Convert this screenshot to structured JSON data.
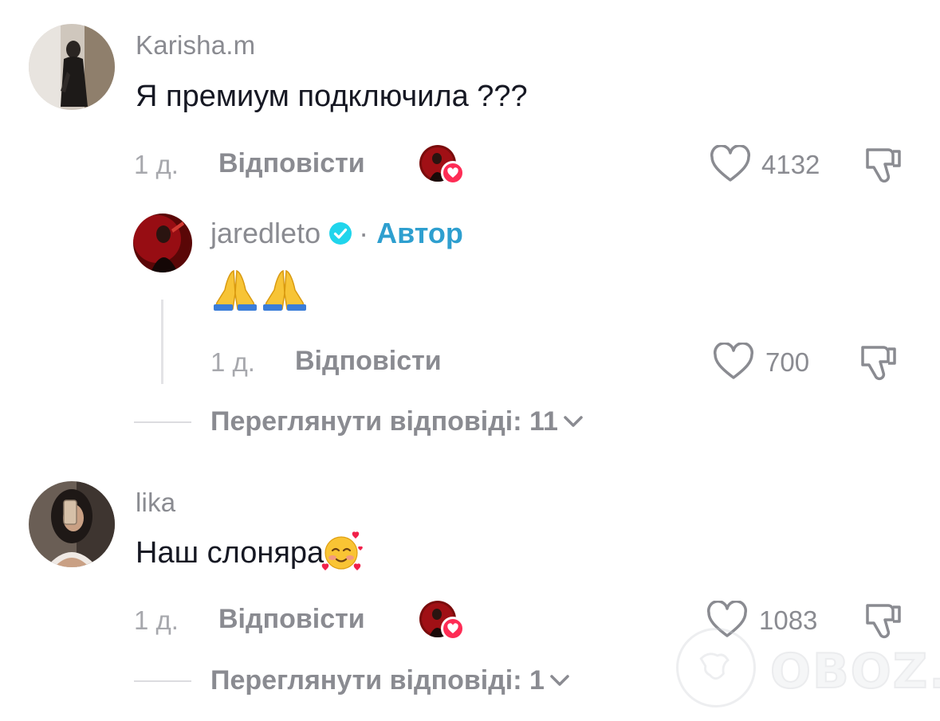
{
  "comments": [
    {
      "username": "Karisha.m",
      "text": "Я премиум подключила ???",
      "time": "1 д.",
      "reply_label": "Відповісти",
      "likes": "4132",
      "view_replies": "Переглянути відповіді: 11"
    },
    {
      "username": "lika",
      "text": "Наш слоняра",
      "time": "1 д.",
      "reply_label": "Відповісти",
      "likes": "1083",
      "view_replies": "Переглянути відповіді: 1"
    }
  ],
  "reply": {
    "username": "jaredleto",
    "role": "Автор",
    "separator": "·",
    "time": "1 д.",
    "reply_label": "Відповісти",
    "likes": "700"
  },
  "watermark": {
    "text": "OBOZ.UA"
  },
  "colors": {
    "accent": "#2e9fcf",
    "heart_badge": "#fe2c55",
    "secondary_text": "#8a8b91"
  },
  "icons": [
    "heart-icon",
    "dislike-icon",
    "verified-icon",
    "chevron-down-icon",
    "folded-hands-emoji",
    "smiling-hearts-emoji"
  ]
}
